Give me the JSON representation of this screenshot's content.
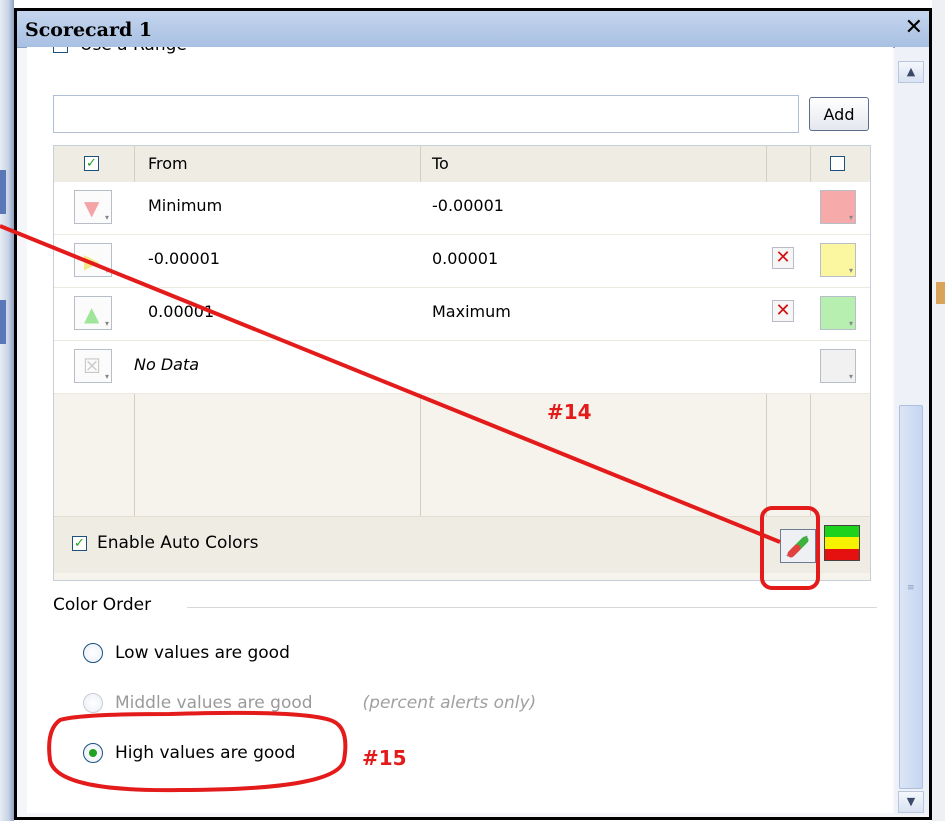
{
  "window": {
    "title": "Scorecard 1",
    "close_glyph": "✕"
  },
  "range": {
    "use_range_label": "Use a Range",
    "use_range_checked": false,
    "input_value": "",
    "add_label": "Add"
  },
  "grid": {
    "columns": {
      "from": "From",
      "to": "To"
    },
    "rows": [
      {
        "from": "Minimum",
        "to": "-0.00001",
        "icon": "red-down-arrow-icon",
        "color": "#f7aaaa",
        "deletable": false
      },
      {
        "from": "-0.00001",
        "to": "0.00001",
        "icon": "yellow-right-arrow-icon",
        "color": "#fbf6a0",
        "deletable": true
      },
      {
        "from": "0.00001",
        "to": "Maximum",
        "icon": "green-up-arrow-icon",
        "color": "#b7efb0",
        "deletable": true
      },
      {
        "from": "No Data",
        "to": "",
        "icon": "no-data-icon",
        "color": "#f1f1f1",
        "deletable": false
      }
    ],
    "enable_auto_colors": "Enable Auto Colors"
  },
  "color_order": {
    "heading": "Color Order",
    "options": {
      "low": "Low values are good",
      "middle": "Middle values are good",
      "middle_note": "(percent alerts only)",
      "high": "High values are good"
    },
    "selected": "high"
  },
  "annotations": {
    "a14": "#14",
    "a15": "#15"
  },
  "colors": {
    "annotation_red": "#e41b1b",
    "check_green": "#21a121",
    "band_green": "#1dd21d",
    "band_yellow": "#f6f200",
    "band_red": "#e51111"
  }
}
